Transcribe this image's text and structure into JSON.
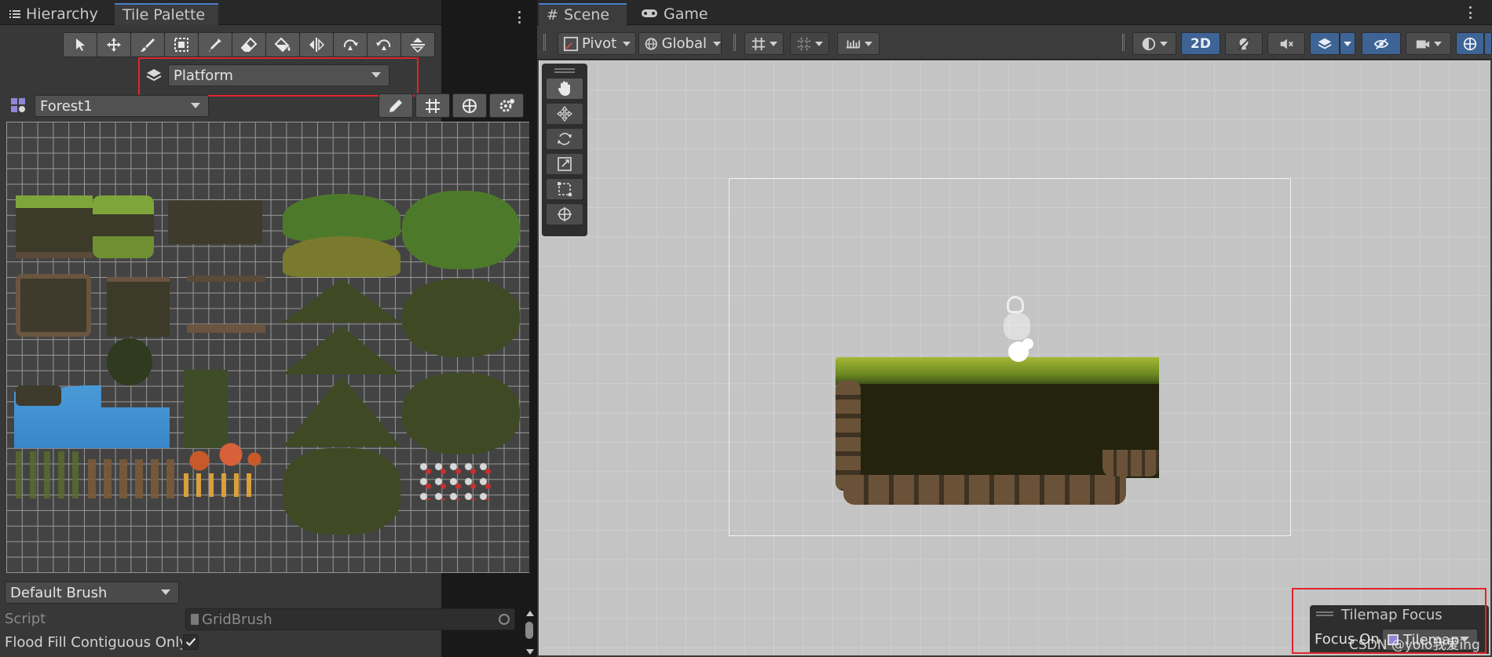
{
  "left_panel": {
    "tabs": [
      {
        "label": "Hierarchy",
        "icon": "list-icon"
      },
      {
        "label": "Tile Palette",
        "icon": ""
      }
    ],
    "tools": [
      "select-tool-icon",
      "move-tool-icon",
      "paint-brush-icon",
      "box-fill-icon",
      "picker-icon",
      "eraser-icon",
      "flood-fill-icon",
      "flip-x-icon",
      "rotate-cw-icon",
      "rotate-ccw-icon",
      "flip-y-icon"
    ],
    "active_target": "Platform",
    "palette": "Forest1",
    "palette_tools": [
      "edit-pencil-icon",
      "grid-toggle-icon",
      "gizmo-icon",
      "palette-settings-icon"
    ],
    "brush": "Default Brush",
    "script_label": "Script",
    "script_value": "GridBrush",
    "flood_fill_label": "Flood Fill Contiguous Only",
    "flood_fill_checked": true
  },
  "right_panel": {
    "tabs": [
      {
        "label": "Scene",
        "icon": "hash-icon"
      },
      {
        "label": "Game",
        "icon": "gamepad-icon"
      }
    ],
    "toolbar": {
      "pivot": "Pivot",
      "global": "Global",
      "mode_2d": "2D"
    },
    "overlay": {
      "title": "Tilemap Focus",
      "focus_label": "Focus On",
      "focus_value": "Tilemap"
    },
    "watermark": "CSDN @yolo我爱ing"
  },
  "colors": {
    "accent_blue": "#3e6395",
    "highlight_red": "#e0252b",
    "panel_bg": "#383838"
  }
}
